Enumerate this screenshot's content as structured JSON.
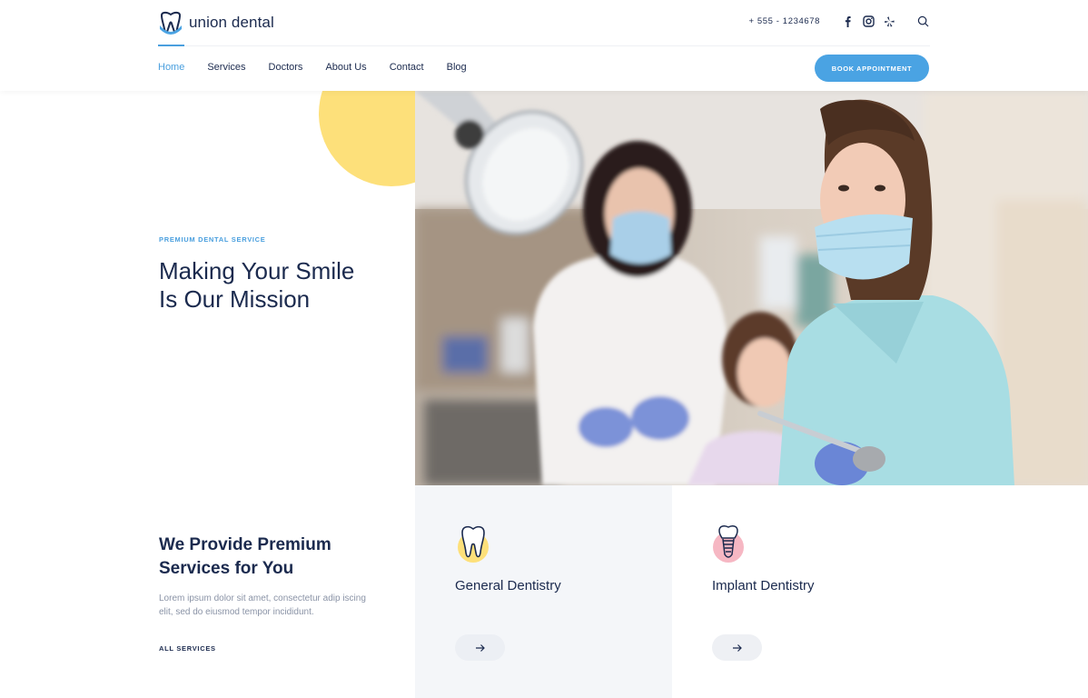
{
  "brand": {
    "name": "union dental"
  },
  "topbar": {
    "phone": "+ 555 - 1234678",
    "icons": [
      "facebook-icon",
      "instagram-icon",
      "yelp-icon",
      "search-icon"
    ]
  },
  "nav": {
    "items": [
      {
        "label": "Home",
        "active": true
      },
      {
        "label": "Services",
        "active": false
      },
      {
        "label": "Doctors",
        "active": false
      },
      {
        "label": "About Us",
        "active": false
      },
      {
        "label": "Contact",
        "active": false
      },
      {
        "label": "Blog",
        "active": false
      }
    ],
    "cta_label": "BOOK APPOINTMENT"
  },
  "hero": {
    "eyebrow": "PREMIUM DENTAL SERVICE",
    "title": "Making Your Smile Is Our Mission"
  },
  "services": {
    "title": "We Provide Premium Services for You",
    "description": "Lorem ipsum dolor sit amet, consectetur adip iscing elit, sed do eiusmod tempor incididunt.",
    "link_label": "ALL SERVICES",
    "cards": [
      {
        "title": "General Dentistry",
        "icon": "tooth-icon"
      },
      {
        "title": "Implant Dentistry",
        "icon": "implant-icon"
      }
    ]
  },
  "colors": {
    "accent": "#4aa3e3",
    "navy": "#1b2a4e",
    "yellow": "#fde07a",
    "pink": "#f6b7c3",
    "card_bg": "#f4f6f9"
  }
}
